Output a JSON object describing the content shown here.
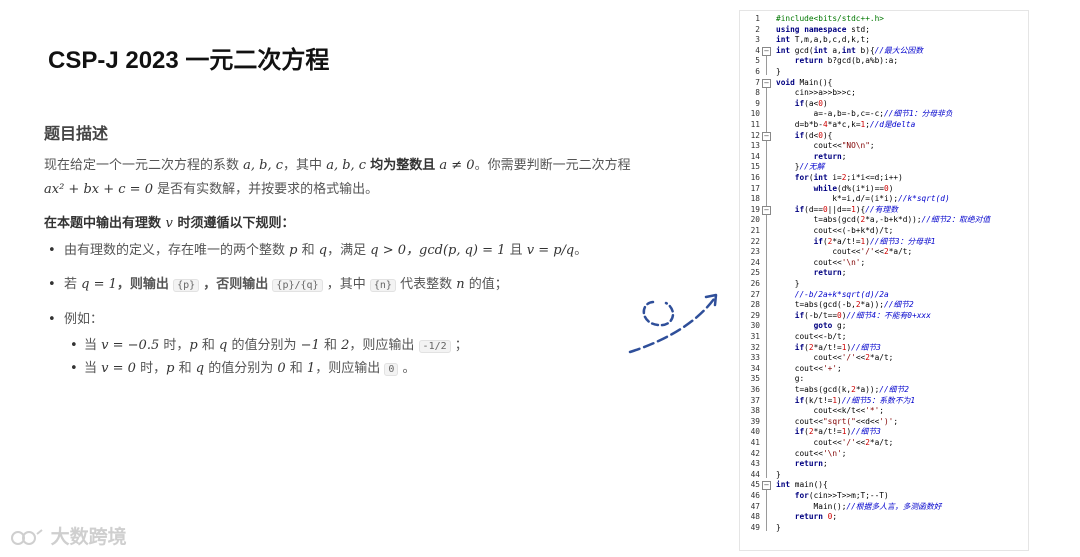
{
  "slide_title": "CSP-J 2023 一元二次方程",
  "section_heading": "题目描述",
  "description": {
    "p1_a": "现在给定一个一元二次方程的系数",
    "p1_vars": "a, b, c",
    "p1_b": "，其中",
    "p1_vars2": "a, b, c",
    "p1_bold": "均为整数且",
    "p1_cond": "a ≠ 0",
    "p1_c": "。你需要判断一元二次方程",
    "p2_eq": "ax² + bx + c = 0",
    "p2_a": "是否有实数解，并按要求的格式输出。"
  },
  "rule_heading": {
    "a": "在本题中输出有理数",
    "v": "v",
    "b": "时须遵循以下规则："
  },
  "rules": {
    "r1_a": "由有理数的定义，存在唯一的两个整数",
    "r1_p": "p",
    "r1_b": "和",
    "r1_q": "q",
    "r1_c": "，满足",
    "r1_cond": "q > 0，gcd(p, q) = 1",
    "r1_d": "且",
    "r1_v": "v = p/q",
    "r1_e": "。",
    "r2_a": "若",
    "r2_cond": "q = 1",
    "r2_b": "，则输出",
    "r2_code1": "{p}",
    "r2_c": "，否则输出",
    "r2_code2": "{p}/{q}",
    "r2_d": "，其中",
    "r2_code3": "{n}",
    "r2_e": "代表整数",
    "r2_n": "n",
    "r2_f": "的值；",
    "r3": "例如：",
    "ex1_a": "当",
    "ex1_v": "v = −0.5",
    "ex1_b": "时，",
    "ex1_p": "p",
    "ex1_c": "和",
    "ex1_q": "q",
    "ex1_d": "的值分别为",
    "ex1_vals": "−1",
    "ex1_e": "和",
    "ex1_vals2": "2",
    "ex1_f": "，则应输出",
    "ex1_code": "-1/2",
    "ex1_g": "；",
    "ex2_a": "当",
    "ex2_v": "v = 0",
    "ex2_b": "时，",
    "ex2_p": "p",
    "ex2_c": "和",
    "ex2_q": "q",
    "ex2_d": "的值分别为",
    "ex2_vals": "0",
    "ex2_e": "和",
    "ex2_vals2": "1",
    "ex2_f": "，则应输出",
    "ex2_code": "0",
    "ex2_g": "。"
  },
  "watermark": "大数跨境",
  "colors": {
    "comment": "#0000cc",
    "keyword": "#000080",
    "preprocessor": "#007700",
    "string": "#800000",
    "arrow": "#2f4f9a"
  },
  "code_lines": [
    "#include<bits/stdc++.h>",
    "using namespace std;",
    "int T,m,a,b,c,d,k,t;",
    "int gcd(int a,int b){//最大公因数",
    "    return b?gcd(b,a%b):a;",
    "}",
    "void Main(){",
    "    cin>>a>>b>>c;",
    "    if(a<0)",
    "        a=-a,b=-b,c=-c;//细节1：分母非负",
    "    d=b*b-4*a*c,k=1;//d是delta",
    "    if(d<0){",
    "        cout<<\"NO\\n\";",
    "        return;",
    "    }//无解",
    "    for(int i=2;i*i<=d;i++)",
    "        while(d%(i*i)==0)",
    "            k*=i,d/=(i*i);//k*sqrt(d)",
    "    if(d==0||d==1){//有理数",
    "        t=abs(gcd(2*a,-b+k*d));//细节2：取绝对值",
    "        cout<<(-b+k*d)/t;",
    "        if(2*a/t!=1)//细节3：分母非1",
    "            cout<<'/'<<2*a/t;",
    "        cout<<'\\n';",
    "        return;",
    "    }",
    "    //-b/2a+k*sqrt(d)/2a",
    "    t=abs(gcd(-b,2*a));//细节2",
    "    if(-b/t==0)//细节4：不能有0+xxx",
    "        goto g;",
    "    cout<<-b/t;",
    "    if(2*a/t!=1)//细节3",
    "        cout<<'/'<<2*a/t;",
    "    cout<<'+';",
    "    g:",
    "    t=abs(gcd(k,2*a));//细节2",
    "    if(k/t!=1)//细节5：系数不为1",
    "        cout<<k/t<<'*';",
    "    cout<<\"sqrt(\"<<d<<')';",
    "    if(2*a/t!=1)//细节3",
    "        cout<<'/'<<2*a/t;",
    "    cout<<'\\n';",
    "    return;",
    "}",
    "int main(){",
    "    for(cin>>T>>m;T;--T)",
    "        Main();//根据多人言，多测函数好",
    "    return 0;",
    "}"
  ],
  "line_numbers": [
    "1",
    "2",
    "3",
    "4",
    "5",
    "6",
    "7",
    "8",
    "9",
    "10",
    "11",
    "12",
    "13",
    "14",
    "15",
    "16",
    "17",
    "18",
    "19",
    "20",
    "21",
    "22",
    "23",
    "24",
    "25",
    "26",
    "27",
    "28",
    "29",
    "30",
    "31",
    "32",
    "33",
    "34",
    "35",
    "36",
    "37",
    "38",
    "39",
    "40",
    "41",
    "42",
    "43",
    "44",
    "45",
    "46",
    "47",
    "48",
    "49"
  ]
}
